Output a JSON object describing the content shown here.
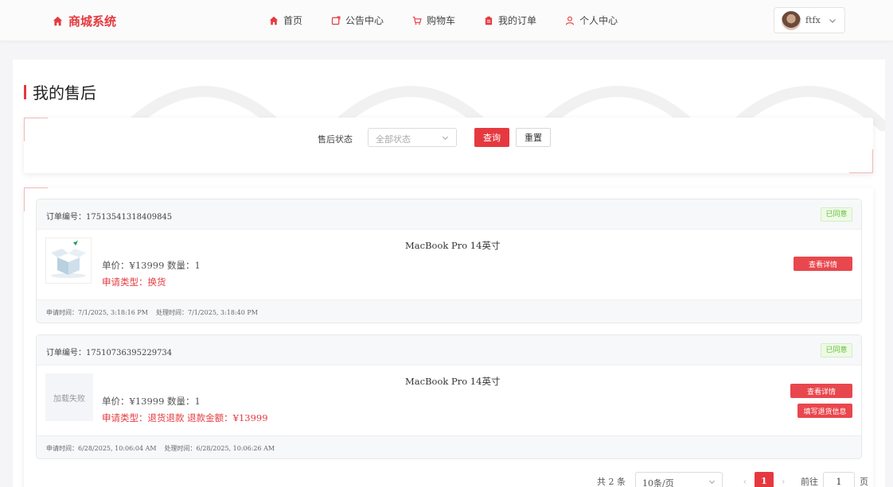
{
  "header": {
    "brand": "商城系统",
    "nav": [
      {
        "label": "首页",
        "icon": "home-icon"
      },
      {
        "label": "公告中心",
        "icon": "notice-icon"
      },
      {
        "label": "购物车",
        "icon": "cart-icon"
      },
      {
        "label": "我的订单",
        "icon": "order-icon"
      },
      {
        "label": "个人中心",
        "icon": "user-icon"
      }
    ],
    "username": "ftfx"
  },
  "page": {
    "title": "我的售后"
  },
  "filter": {
    "label": "售后状态",
    "select_placeholder": "全部状态",
    "query_label": "查询",
    "reset_label": "重置"
  },
  "orders": [
    {
      "order_no": "订单编号：17513541318409845",
      "status": "已同意",
      "product_name": "MacBook Pro 14英寸",
      "price_qty": "单价：¥13999  数量：1",
      "apply_type": "申请类型：换货",
      "image_state": "loaded",
      "actions": [
        "查看详情"
      ],
      "apply_time": "申请时间：7/1/2025, 3:18:16 PM",
      "process_time": "处理时间：7/1/2025, 3:18:40 PM"
    },
    {
      "order_no": "订单编号：17510736395229734",
      "status": "已同意",
      "product_name": "MacBook Pro 14英寸",
      "price_qty": "单价：¥13999  数量：1",
      "apply_type": "申请类型：退货退款  退款金额：¥13999",
      "image_state": "加载失败",
      "actions": [
        "查看详情",
        "填写退货信息"
      ],
      "apply_time": "申请时间：6/28/2025, 10:06:04 AM",
      "process_time": "处理时间：6/28/2025, 10:06:26 AM"
    }
  ],
  "pagination": {
    "total": "共 2 条",
    "page_size": "10条/页",
    "current_page": "1",
    "goto_label": "前往",
    "goto_value": "1",
    "page_suffix": "页"
  },
  "colors": {
    "accent": "#e5393f",
    "success": "#67c23a"
  }
}
